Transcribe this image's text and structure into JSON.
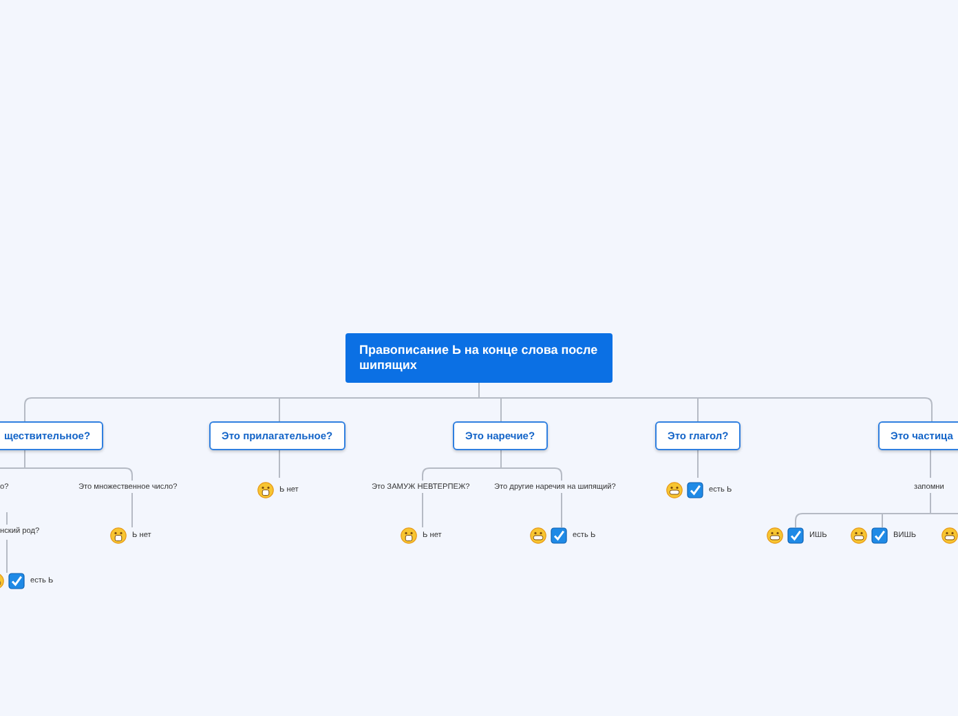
{
  "root": {
    "kind": "central",
    "text": "Правописание Ь на конце слова после шипящих",
    "children": [
      {
        "kind": "topic",
        "text": "ществительное?",
        "children": [
          {
            "kind": "question",
            "text": "о?",
            "children": [
              {
                "kind": "question",
                "text": "нский род?",
                "children": [
                  {
                    "kind": "yes",
                    "text": "есть Ь"
                  }
                ]
              }
            ]
          },
          {
            "kind": "question",
            "text": "Это множественное число?",
            "children": [
              {
                "kind": "no",
                "text": "Ь нет"
              }
            ]
          }
        ]
      },
      {
        "kind": "topic",
        "text": "Это прилагательное?",
        "children": [
          {
            "kind": "no",
            "text": "Ь нет"
          }
        ]
      },
      {
        "kind": "topic",
        "text": "Это наречие?",
        "children": [
          {
            "kind": "question",
            "text": "Это ЗАМУЖ НЕВТЕРПЕЖ?",
            "children": [
              {
                "kind": "no",
                "text": "Ь нет"
              }
            ]
          },
          {
            "kind": "question",
            "text": "Это другие наречия на шипящий?",
            "children": [
              {
                "kind": "yes",
                "text": "есть Ь"
              }
            ]
          }
        ]
      },
      {
        "kind": "topic",
        "text": "Это глагол?",
        "children": [
          {
            "kind": "yes",
            "text": "есть Ь"
          }
        ]
      },
      {
        "kind": "topic",
        "text": "Это частица",
        "children": [
          {
            "kind": "question",
            "text": "запомни",
            "children": [
              {
                "kind": "yes",
                "text": "ИШЬ"
              },
              {
                "kind": "yes",
                "text": "ВИШЬ"
              },
              {
                "kind": "yes"
              }
            ]
          }
        ]
      }
    ]
  }
}
